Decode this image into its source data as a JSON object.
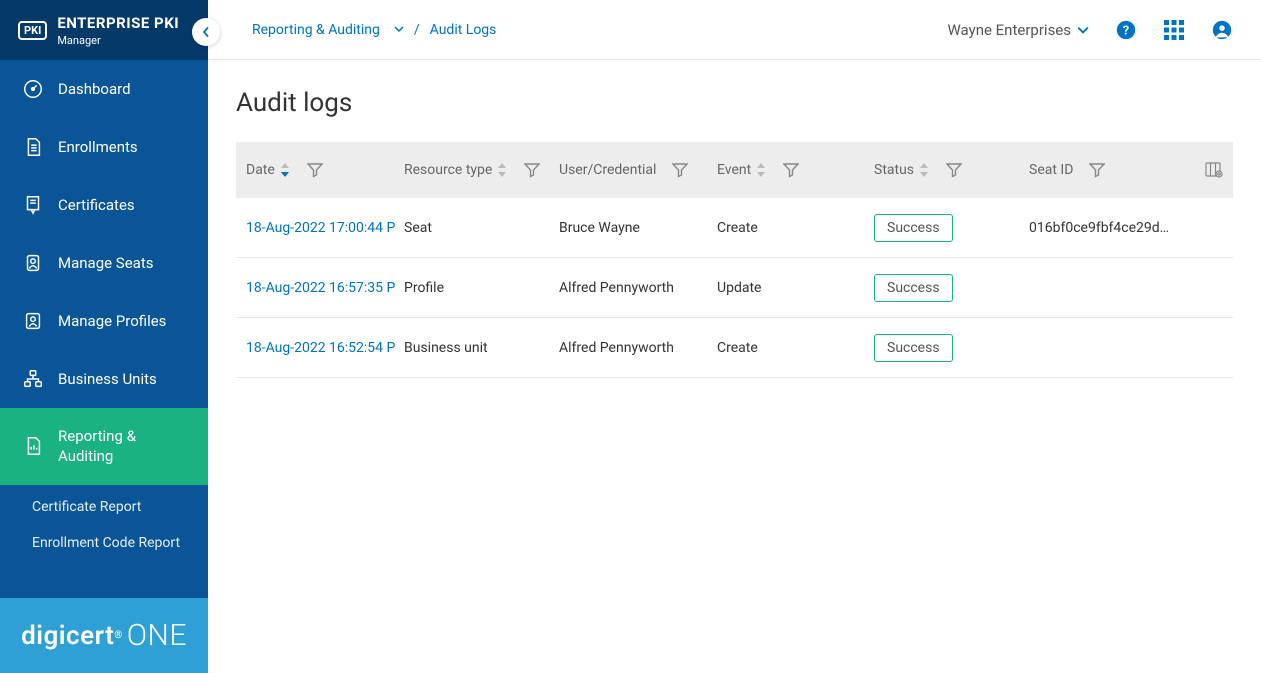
{
  "brand": {
    "logo_box": "PKI",
    "title": "ENTERPRISE PKI",
    "subtitle": "Manager",
    "footer_bold": "digicert",
    "footer_light": "ONE"
  },
  "sidebar": {
    "items": [
      {
        "id": "dashboard",
        "label": "Dashboard"
      },
      {
        "id": "enrollments",
        "label": "Enrollments"
      },
      {
        "id": "certificates",
        "label": "Certificates"
      },
      {
        "id": "manage-seats",
        "label": "Manage Seats"
      },
      {
        "id": "manage-profiles",
        "label": "Manage Profiles"
      },
      {
        "id": "business-units",
        "label": "Business Units"
      },
      {
        "id": "reporting",
        "label": "Reporting & Auditing"
      }
    ],
    "subnav": [
      {
        "id": "cert-report",
        "label": "Certificate Report"
      },
      {
        "id": "enroll-report",
        "label": "Enrollment Code Report"
      }
    ]
  },
  "header": {
    "breadcrumb_parent": "Reporting & Auditing",
    "breadcrumb_current": "Audit Logs",
    "tenant": "Wayne Enterprises"
  },
  "page": {
    "title": "Audit logs"
  },
  "table": {
    "columns": {
      "date": "Date",
      "rtype": "Resource type",
      "user": "User/Credential",
      "event": "Event",
      "status": "Status",
      "seat": "Seat ID"
    },
    "rows": [
      {
        "date": "18-Aug-2022 17:00:44 P",
        "rtype": "Seat",
        "user": "Bruce Wayne",
        "event": "Create",
        "status": "Success",
        "seat": "016bf0ce9fbf4ce29d…"
      },
      {
        "date": "18-Aug-2022 16:57:35 P",
        "rtype": "Profile",
        "user": "Alfred Pennyworth",
        "event": "Update",
        "status": "Success",
        "seat": ""
      },
      {
        "date": "18-Aug-2022 16:52:54 P",
        "rtype": "Business unit",
        "user": "Alfred Pennyworth",
        "event": "Create",
        "status": "Success",
        "seat": ""
      }
    ]
  }
}
